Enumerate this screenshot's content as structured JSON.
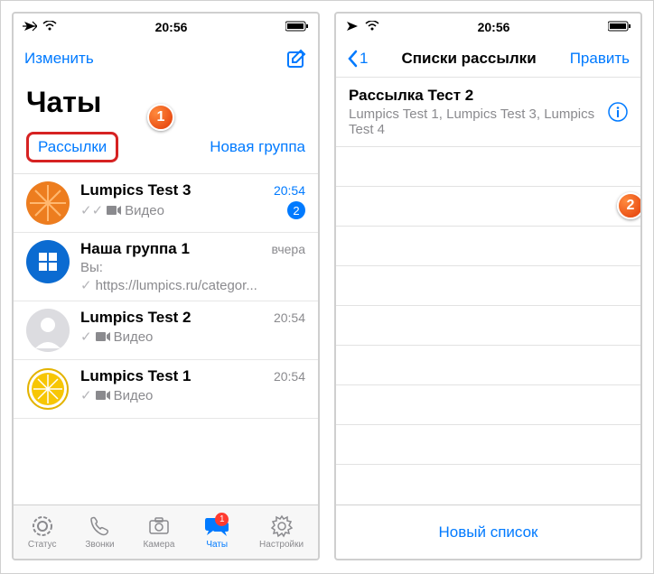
{
  "colors": {
    "primary": "#007aff",
    "badge_red": "#ff3b30",
    "highlight_red": "#d62222"
  },
  "annotations": {
    "left": "1",
    "right": "2"
  },
  "left": {
    "status": {
      "time": "20:56"
    },
    "nav": {
      "edit": "Изменить"
    },
    "title": "Чаты",
    "links": {
      "broadcasts": "Рассылки",
      "new_group": "Новая группа"
    },
    "chats": [
      {
        "name": "Lumpics Test 3",
        "time": "20:54",
        "time_blue": true,
        "snippet": "Видео",
        "badge": "2",
        "avatar": "orange"
      },
      {
        "name": "Наша группа 1",
        "time": "вчера",
        "prefix": "Вы:",
        "snippet": "https://lumpics.ru/categor...",
        "avatar": "windows"
      },
      {
        "name": "Lumpics Test 2",
        "time": "20:54",
        "snippet": "Видео",
        "avatar": "placeholder"
      },
      {
        "name": "Lumpics Test 1",
        "time": "20:54",
        "snippet": "Видео",
        "avatar": "lemon"
      }
    ],
    "tabs": {
      "status": "Статус",
      "calls": "Звонки",
      "camera": "Камера",
      "chats": "Чаты",
      "chats_badge": "1",
      "settings": "Настройки"
    }
  },
  "right": {
    "status": {
      "time": "20:56"
    },
    "nav": {
      "back": "1",
      "title": "Списки рассылки",
      "edit": "Править"
    },
    "list": {
      "title": "Рассылка Тест 2",
      "recipients": "Lumpics Test 1, Lumpics Test 3, Lumpics Test 4"
    },
    "new_list": "Новый список"
  }
}
